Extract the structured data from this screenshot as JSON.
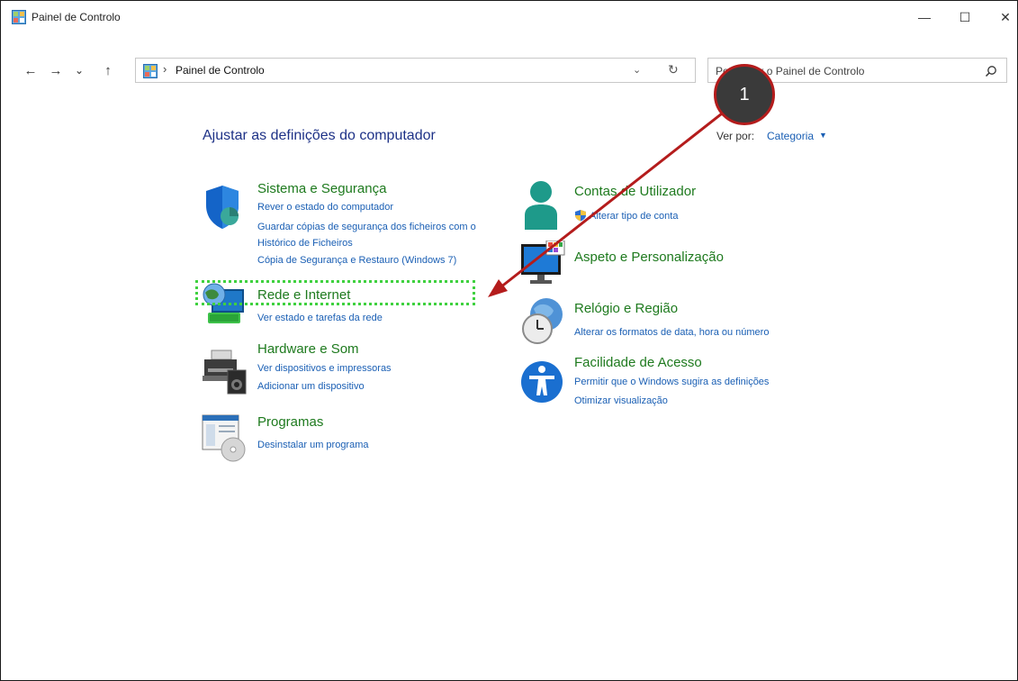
{
  "window": {
    "title": "Painel de Controlo",
    "controls": {
      "minimize": "—",
      "maximize": "☐",
      "close": "✕"
    }
  },
  "nav": {
    "back": "←",
    "forward": "→",
    "recent": "⌄",
    "up": "↑",
    "breadcrumb_sep": "›",
    "address": "Painel de Controlo",
    "address_dropdown": "⌄",
    "refresh": "↻",
    "search_placeholder": "Pesquisar o Painel de Controlo"
  },
  "main": {
    "heading": "Ajustar as definições do computador",
    "view_by_label": "Ver por:",
    "view_by_value": "Categoria",
    "view_by_caret": "▼"
  },
  "categories": {
    "system": {
      "icon": "shield-icon",
      "title": "Sistema e Segurança",
      "links": [
        "Rever o estado do computador",
        "Guardar cópias de segurança dos ficheiros com o",
        "Histórico de Ficheiros",
        "Cópia de Segurança e Restauro (Windows 7)"
      ]
    },
    "network": {
      "icon": "network-globe-icon",
      "title": "Rede e Internet",
      "links": [
        "Ver estado e tarefas da rede"
      ]
    },
    "hardware": {
      "icon": "printer-speaker-icon",
      "title": "Hardware e Som",
      "links": [
        "Ver dispositivos e impressoras",
        "Adicionar um dispositivo"
      ]
    },
    "programs": {
      "icon": "programs-icon",
      "title": "Programas",
      "links": [
        "Desinstalar um programa"
      ]
    },
    "accounts": {
      "icon": "user-icon",
      "title": "Contas de Utilizador",
      "links": [
        "Alterar tipo de conta"
      ]
    },
    "appearance": {
      "icon": "monitor-paint-icon",
      "title": "Aspeto e Personalização",
      "links": []
    },
    "clock": {
      "icon": "clock-globe-icon",
      "title": "Relógio e Região",
      "links": [
        "Alterar os formatos de data, hora ou número"
      ]
    },
    "access": {
      "icon": "accessibility-icon",
      "title": "Facilidade de Acesso",
      "links": [
        "Permitir que o Windows sugira as definições",
        "Otimizar visualização"
      ]
    }
  },
  "annotation": {
    "step_number": "1",
    "highlight_color": "#3fd13f",
    "arrow_color": "#b41c1c"
  }
}
